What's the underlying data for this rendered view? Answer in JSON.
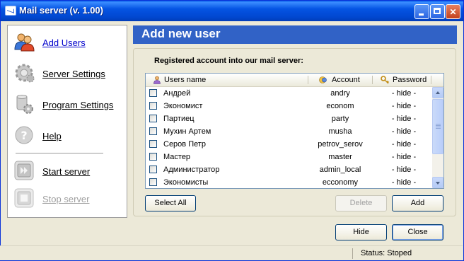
{
  "window": {
    "title": "Mail server (v. 1.00)"
  },
  "nav": {
    "items": [
      {
        "label": "Add Users",
        "icon": "users-icon",
        "state": "active"
      },
      {
        "label": "Server Settings",
        "icon": "server-gear-icon",
        "state": "normal"
      },
      {
        "label": "Program Settings",
        "icon": "program-gear-icon",
        "state": "normal"
      },
      {
        "label": "Help",
        "icon": "help-icon",
        "state": "normal"
      },
      {
        "label": "Start server",
        "icon": "start-icon",
        "state": "normal"
      },
      {
        "label": "Stop server",
        "icon": "stop-icon",
        "state": "disabled"
      }
    ]
  },
  "main": {
    "header": "Add new user",
    "caption": "Registered account into our mail server:",
    "columns": {
      "name": "Users name",
      "account": "Account",
      "password": "Password"
    },
    "users": [
      {
        "name": "Андрей",
        "account": "andry",
        "password": "- hide -"
      },
      {
        "name": "Экономист",
        "account": "econom",
        "password": "- hide -"
      },
      {
        "name": "Партиец",
        "account": "party",
        "password": "- hide -"
      },
      {
        "name": "Мухин Артем",
        "account": "musha",
        "password": "- hide -"
      },
      {
        "name": "Серов Петр",
        "account": "petrov_serov",
        "password": "- hide -"
      },
      {
        "name": "Мастер",
        "account": "master",
        "password": "- hide -"
      },
      {
        "name": "Администратор",
        "account": "admin_local",
        "password": "- hide -"
      },
      {
        "name": "Экономисты",
        "account": "ecconomy",
        "password": "- hide -"
      }
    ],
    "buttons": {
      "select_all": "Select All",
      "delete": "Delete",
      "add": "Add"
    }
  },
  "footer": {
    "hide": "Hide",
    "close": "Close"
  },
  "status": {
    "text": "Status: Stoped"
  },
  "colors": {
    "titlebar": "#0554e3",
    "header_band": "#3162c6",
    "link_active": "#0000cc",
    "disabled": "#a0a0a0"
  }
}
